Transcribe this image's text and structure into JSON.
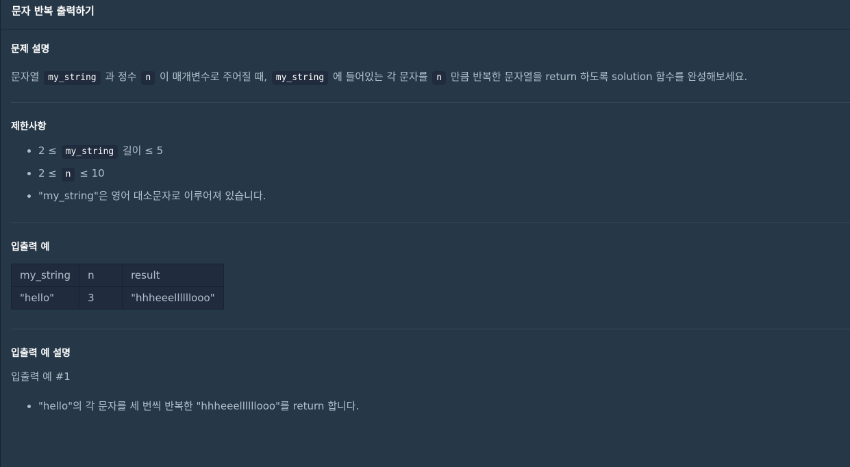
{
  "header": {
    "title": "문자 반복 출력하기"
  },
  "description": {
    "heading": "문제 설명",
    "parts": [
      {
        "type": "text",
        "value": "문자열 "
      },
      {
        "type": "code",
        "value": "my_string"
      },
      {
        "type": "text",
        "value": " 과 정수 "
      },
      {
        "type": "code",
        "value": "n"
      },
      {
        "type": "text",
        "value": " 이 매개변수로 주어질 때, "
      },
      {
        "type": "code",
        "value": "my_string"
      },
      {
        "type": "text",
        "value": " 에 들어있는 각 문자를 "
      },
      {
        "type": "code",
        "value": "n"
      },
      {
        "type": "text",
        "value": " 만큼 반복한 문자열을 return 하도록 solution 함수를 완성해보세요."
      }
    ]
  },
  "constraints": {
    "heading": "제한사항",
    "items": [
      {
        "pre": "2 ≤ ",
        "code": "my_string",
        "post": " 길이 ≤ 5"
      },
      {
        "pre": "2 ≤ ",
        "code": "n",
        "post": " ≤ 10"
      },
      {
        "pre": "\"my_string\"은 영어 대소문자로 이루어져 있습니다.",
        "code": "",
        "post": ""
      }
    ]
  },
  "examples": {
    "heading": "입출력 예",
    "columns": [
      "my_string",
      "n",
      "result"
    ],
    "rows": [
      [
        "\"hello\"",
        "3",
        "\"hhheeellllllooo\""
      ]
    ]
  },
  "explanation": {
    "heading": "입출력 예 설명",
    "subheading": "입출력 예 #1",
    "items": [
      "\"hello\"의 각 문자를 세 번씩 반복한 \"hhheeellllllooo\"를 return 합니다."
    ]
  }
}
